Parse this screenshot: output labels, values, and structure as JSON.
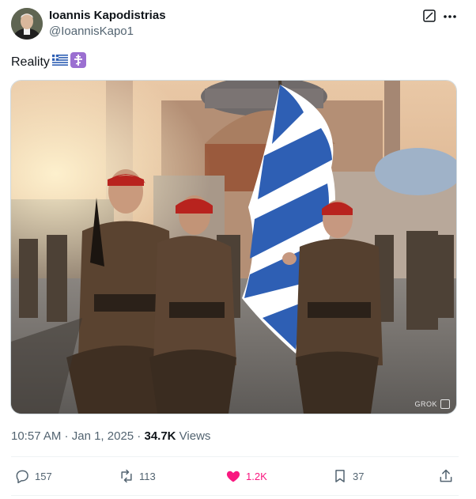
{
  "author": {
    "name": "Ioannis Kapodistrias",
    "handle": "@IoannisKapo1"
  },
  "tweet": {
    "text": "Reality",
    "emojis": [
      "greek-flag-emoji",
      "orthodox-cross-emoji"
    ]
  },
  "media": {
    "watermark": "GROK"
  },
  "meta": {
    "time": "10:57 AM",
    "separator1": " · ",
    "date": "Jan 1, 2025",
    "separator2": " · ",
    "views_count": "34.7K",
    "views_label": " Views"
  },
  "actions": {
    "replies": "157",
    "reposts": "113",
    "likes": "1.2K",
    "bookmarks": "37"
  },
  "colors": {
    "like": "#f91880",
    "muted": "#536471",
    "text": "#0f1419",
    "flag_blue": "#2e5fb4"
  }
}
